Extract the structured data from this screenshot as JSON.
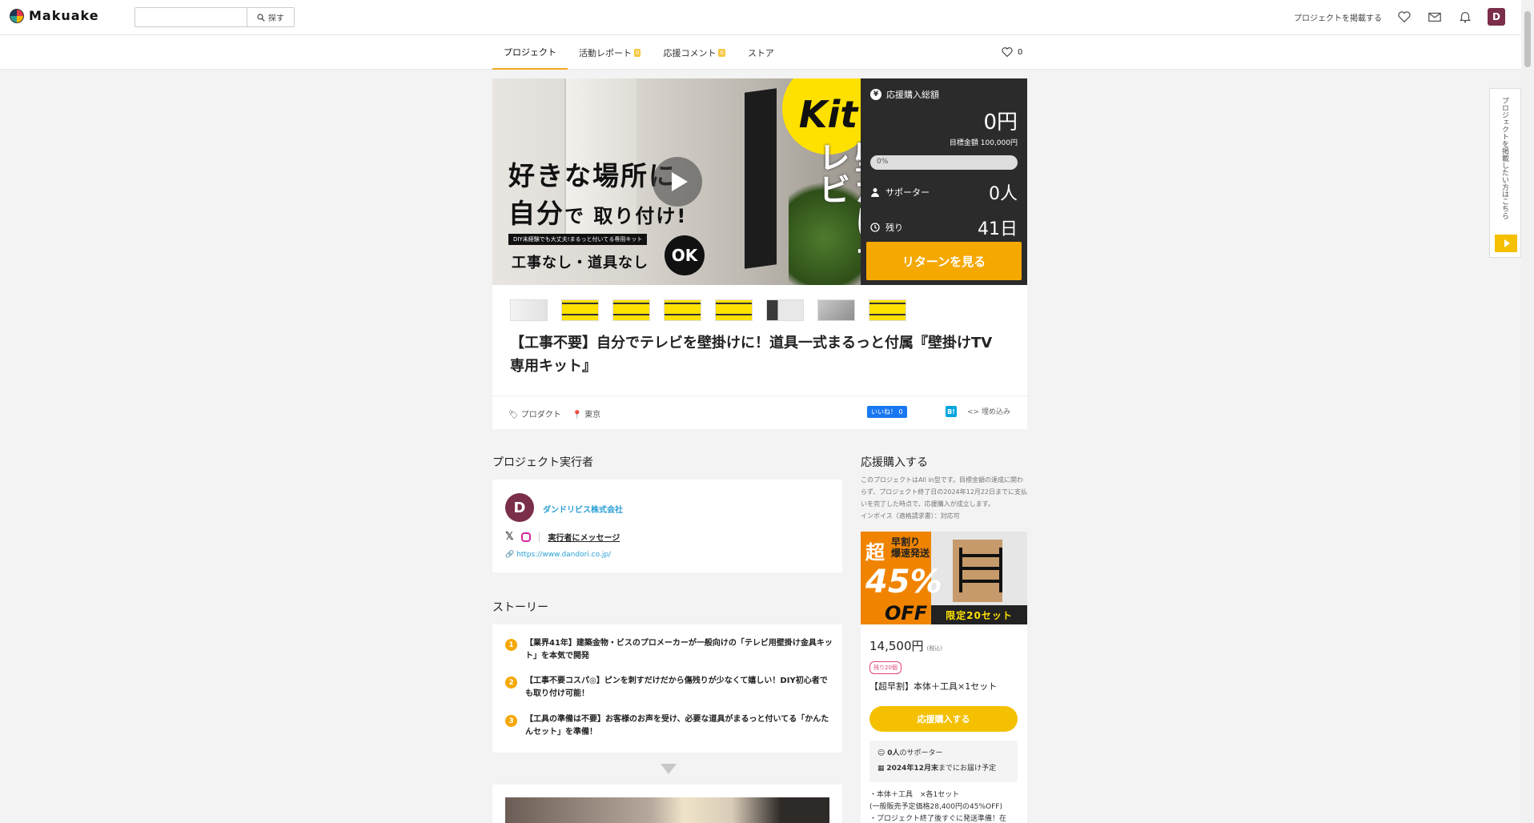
{
  "header": {
    "logo_text": "Makuake",
    "search_placeholder": "",
    "search_button": "探す",
    "post_link": "プロジェクトを掲載する",
    "avatar_letter": "D"
  },
  "tabs": [
    {
      "label": "プロジェクト",
      "badge": ""
    },
    {
      "label": "活動レポート",
      "badge": "0"
    },
    {
      "label": "応援コメント",
      "badge": "0"
    },
    {
      "label": "ストア",
      "badge": ""
    }
  ],
  "favorites_count": "0",
  "hero": {
    "kit": "Kit",
    "vertical": "壁かけテレビ",
    "line1": "好きな場所に",
    "line2_main": "自分",
    "line2_small": "で 取り付け!",
    "strip": "DIY未経験でも大丈夫!まるっと付いてる専用キット",
    "line3": "工事なし・道具なし",
    "ok": "OK"
  },
  "funding": {
    "label": "応援購入総額",
    "amount": "0円",
    "goal": "目標金額 100,000円",
    "progress_text": "0%",
    "progress_fraction": 0,
    "supporters_label": "サポーター",
    "supporters_value": "0人",
    "remaining_label": "残り",
    "remaining_value": "41日",
    "return_button": "リターンを見る"
  },
  "project": {
    "title": "【工事不要】自分でテレビを壁掛けに！道具一式まるっと付属『壁掛けTV専用キット』",
    "category": "プロダクト",
    "location": "東京",
    "fb_like": "いいね！ 0",
    "hatena": "B!",
    "embed": "埋め込み"
  },
  "owner_section": {
    "title": "プロジェクト実行者",
    "avatar_letter": "D",
    "name": "ダンドリビス株式会社",
    "message_link": "実行者にメッセージ",
    "url": "https://www.dandori.co.jp/"
  },
  "story": {
    "title": "ストーリー",
    "items": [
      {
        "num": "1",
        "text": "【業界41年】建築金物・ビスのプロメーカーが一般向けの「テレビ用壁掛け金具キット」を本気で開発"
      },
      {
        "num": "2",
        "text": "【工事不要コスパ◎】ピンを刺すだけだから傷残りが少なくて嬉しい！DIY初心者でも取り付け可能！"
      },
      {
        "num": "3",
        "text": "【工具の準備は不要】お客様のお声を受け、必要な道具がまるっと付いてる「かんたんセット」を準備！"
      }
    ]
  },
  "support_section": {
    "title": "応援購入する",
    "info": "このプロジェクトはAll in型です。目標金額の達成に関わらず、プロジェクト終了日の2024年12月22日までに支払いを完了した時点で、応援購入が成立します。",
    "invoice": "インボイス（適格請求書）：対応可"
  },
  "reward": {
    "banner_big": "超",
    "banner_sub1": "早割り",
    "banner_sub2": "爆速発送",
    "banner_pct": "45%",
    "banner_off": "OFF",
    "banner_limit": "限定20セット",
    "price": "14,500円",
    "tax": "(税込)",
    "remain": "残り20個",
    "name": "【超早割】本体＋工具×1セット",
    "button": "応援購入する",
    "supporters_bold": "0人",
    "supporters_rest": "のサポーター",
    "delivery_bold": "2024年12月末",
    "delivery_rest": "までにお届け予定",
    "desc1": "・本体＋工具　×各1セット",
    "desc2": "(一般販売予定価格28,400円の45%OFF)",
    "desc3": "・プロジェクト終了後すぐに発送準備！在"
  },
  "side_tab": {
    "text": "プロジェクトを掲載したい方はこちら"
  }
}
